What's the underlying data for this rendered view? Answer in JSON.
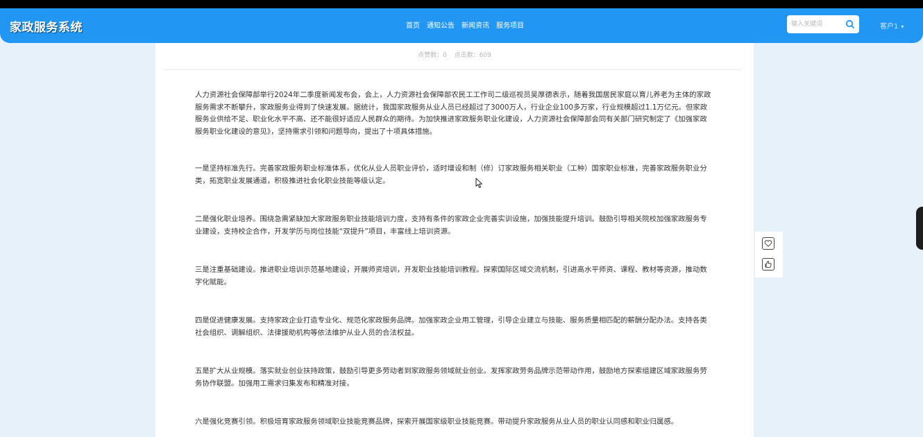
{
  "header": {
    "brand": "家政服务系统",
    "nav": [
      "首页",
      "通知公告",
      "新闻资讯",
      "服务项目"
    ],
    "search_placeholder": "输入关键词",
    "user_label": "客户1"
  },
  "article": {
    "likes_label": "点赞数：0",
    "clicks_label": "点击数：609",
    "paragraphs": [
      "人力资源社会保障部举行2024年二季度新闻发布会，会上，人力资源社会保障部农民工工作司二级巡视员吴厚德表示，随着我国居民家庭以育儿养老为主体的家政服务需求不断攀升，家政服务业得到了快速发展。据统计，我国家政服务从业人员已经超过了3000万人，行业企业100多万家，行业规模超过1.1万亿元。但家政服务业供给不足、职业化水平不高、还不能很好适应人民群众的期待。为加快推进家政服务职业化建设，人力资源社会保障部会同有关部门研究制定了《加强家政服务职业化建设的意见》，坚持需求引领和问题导向，提出了十项具体措施。",
      "一是坚持标准先行。完善家政服务职业标准体系，优化从业人员职业评价，适时增设和制（修）订家政服务相关职业（工种）国家职业标准，完善家政服务职业分类，拓宽职业发展通道，积极推进社会化职业技能等级认定。",
      "二是强化职业培养。围绕急需紧缺加大家政服务职业技能培训力度，支持有条件的家政企业完善实训设施，加强技能提升培训。鼓励引导相关院校加强家政服务专业建设，支持校企合作，开发学历与岗位技能“双提升”项目，丰富线上培训资源。",
      "三是注重基础建设。推进职业培训示范基地建设，开展师资培训，开发职业技能培训教程。探索国际区域交流机制，引进高水平师资、课程、教材等资源，推动数字化赋能。",
      "四是促进健康发展。支持家政企业打造专业化、规范化家政服务品牌。加强家政企业用工管理，引导企业建立与技能、服务质量相匹配的薪酬分配办法。支持各类社会组织、调解组织、法律援助机构等依法维护从业人员的合法权益。",
      "五是扩大从业规模。落实就业创业扶持政策，鼓励引导更多劳动者到家政服务领域就业创业。发挥家政劳务品牌示范带动作用，鼓励地方探索组建区域家政服务劳务协作联盟。加强用工需求归集发布和精准对接。",
      "六是强化竞赛引领。积极培育家政服务领域职业技能竞赛品牌，探索开展国家级职业技能竞赛。带动提升家政服务从业人员的职业认同感和职业归属感。"
    ]
  },
  "colors": {
    "navbar": "#2196f3",
    "page_background": "#e7f1fa",
    "text": "#333333"
  },
  "icons": {
    "search": "search-icon",
    "favorite": "heart-icon",
    "like": "thumbs-up-icon",
    "user_dropdown": "chevron-down-icon"
  }
}
